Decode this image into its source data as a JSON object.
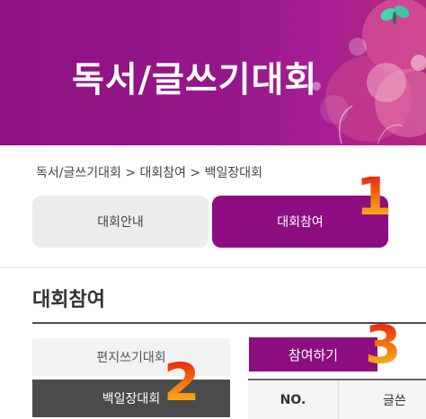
{
  "banner": {
    "title": "독서/글쓰기대회"
  },
  "breadcrumb": "독서/글쓰기대회 > 대회참여 > 백일장대회",
  "tabs": [
    {
      "label": "대회안내",
      "active": false
    },
    {
      "label": "대회참여",
      "active": true
    }
  ],
  "section": {
    "title": "대회참여"
  },
  "side_menu": [
    {
      "label": "편지쓰기대회",
      "active": false
    },
    {
      "label": "백일장대회",
      "active": true
    }
  ],
  "participate_label": "참여하기",
  "table": {
    "headers": [
      "NO.",
      "글쓴"
    ]
  },
  "annotations": [
    "1",
    "2",
    "3"
  ],
  "colors": {
    "brand": "#8c0e80",
    "active_side": "#4b4b4b",
    "annotation": "#f26a10"
  }
}
